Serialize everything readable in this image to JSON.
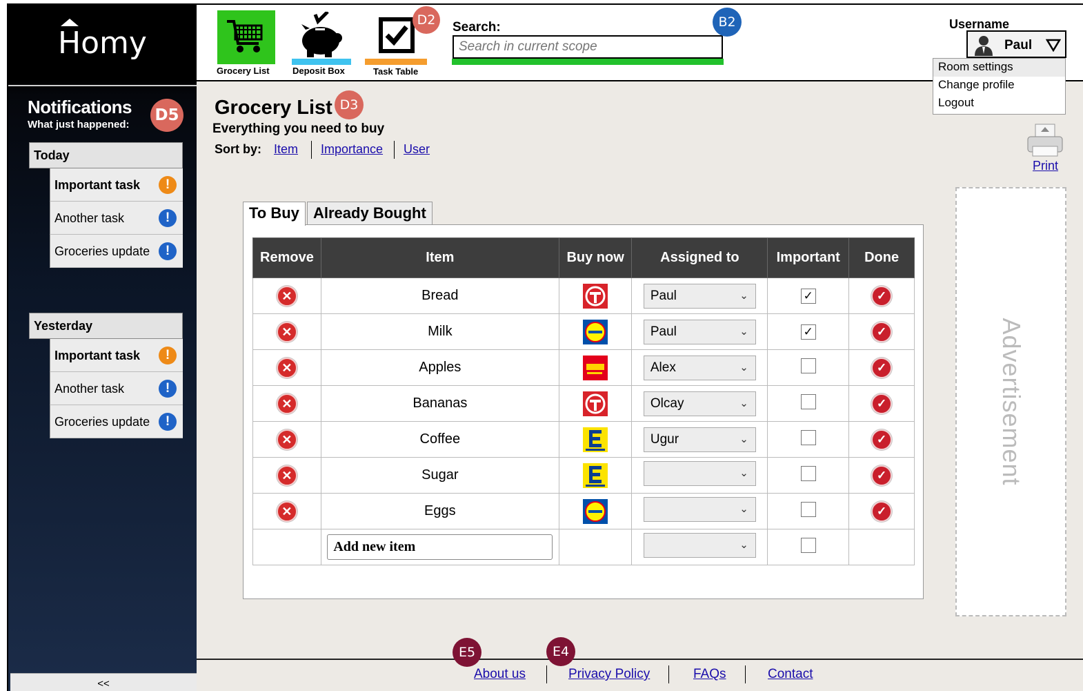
{
  "app": {
    "logo": "Homy"
  },
  "header": {
    "nav": [
      {
        "label": "Grocery List",
        "color": "#2fc41c"
      },
      {
        "label": "Deposit Box",
        "color": "#3fc3ef"
      },
      {
        "label": "Task Table",
        "color": "#f59d2e"
      }
    ],
    "search": {
      "label": "Search:",
      "placeholder": "Search in current scope"
    },
    "user": {
      "label": "Username",
      "name": "Paul",
      "menu": [
        "Room settings",
        "Change profile",
        "Logout"
      ]
    }
  },
  "markers": {
    "d2": "D2",
    "b2": "B2",
    "d3": "D3",
    "d5": "D5",
    "e5": "E5",
    "e4": "E4"
  },
  "sidebar": {
    "title": "Notifications",
    "subtitle": "What just happened:",
    "groups": [
      {
        "heading": "Today",
        "items": [
          {
            "label": "Important task",
            "level": "important"
          },
          {
            "label": "Another task",
            "level": "info"
          },
          {
            "label": "Groceries update",
            "level": "info"
          }
        ]
      },
      {
        "heading": "Yesterday",
        "items": [
          {
            "label": "Important task",
            "level": "important"
          },
          {
            "label": "Another task",
            "level": "info"
          },
          {
            "label": "Groceries update",
            "level": "info"
          }
        ]
      }
    ],
    "collapse_label": "<<"
  },
  "main": {
    "title": "Grocery List",
    "subtitle": "Everything you need to buy",
    "sort_label": "Sort by:",
    "sort_options": [
      "Item",
      "Importance",
      "User"
    ],
    "print_label": "Print",
    "ad_label": "Advertisement",
    "tabs": [
      "To Buy",
      "Already Bought"
    ],
    "columns": [
      "Remove",
      "Item",
      "Buy now",
      "Assigned to",
      "Important",
      "Done"
    ],
    "rows": [
      {
        "item": "Bread",
        "store": "toom",
        "assigned": "Paul",
        "important": true
      },
      {
        "item": "Milk",
        "store": "lidl",
        "assigned": "Paul",
        "important": true
      },
      {
        "item": "Apples",
        "store": "penny",
        "assigned": "Alex",
        "important": false
      },
      {
        "item": "Bananas",
        "store": "toom",
        "assigned": "Olcay",
        "important": false
      },
      {
        "item": "Coffee",
        "store": "edeka",
        "assigned": "Ugur",
        "important": false
      },
      {
        "item": "Sugar",
        "store": "edeka",
        "assigned": "",
        "important": false
      },
      {
        "item": "Eggs",
        "store": "lidl",
        "assigned": "",
        "important": false
      }
    ],
    "add_item_label": "Add new item"
  },
  "footer": {
    "links": [
      "About us",
      "Privacy Policy",
      "FAQs",
      "Contact"
    ]
  }
}
